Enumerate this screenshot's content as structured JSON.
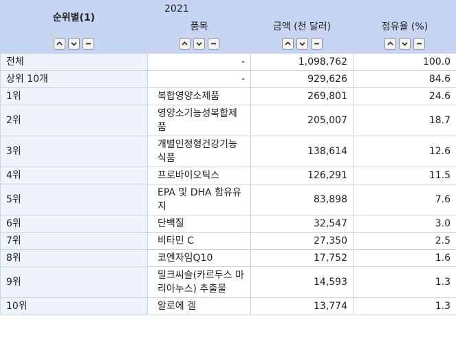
{
  "table": {
    "corner_label": "순위별(1)",
    "year": "2021",
    "columns": [
      "품목",
      "금액 (천 달러)",
      "점유율 (%)"
    ],
    "controls": {
      "up_icon": "chevron-up-icon",
      "down_icon": "chevron-down-icon",
      "minus_icon": "minus-icon"
    },
    "rows": [
      {
        "rank": "전체",
        "item": "-",
        "amount": "1,098,762",
        "share": "100.0"
      },
      {
        "rank": "상위 10개",
        "item": "-",
        "amount": "929,626",
        "share": "84.6"
      },
      {
        "rank": "1위",
        "item": "복합영양소제품",
        "amount": "269,801",
        "share": "24.6"
      },
      {
        "rank": "2위",
        "item": "영양소기능성복합제품",
        "amount": "205,007",
        "share": "18.7"
      },
      {
        "rank": "3위",
        "item": "개별인정형건강기능식품",
        "amount": "138,614",
        "share": "12.6"
      },
      {
        "rank": "4위",
        "item": "프로바이오틱스",
        "amount": "126,291",
        "share": "11.5"
      },
      {
        "rank": "5위",
        "item": "EPA 및 DHA 함유유지",
        "amount": "83,898",
        "share": "7.6"
      },
      {
        "rank": "6위",
        "item": "단백질",
        "amount": "32,547",
        "share": "3.0"
      },
      {
        "rank": "7위",
        "item": "비타민 C",
        "amount": "27,350",
        "share": "2.5"
      },
      {
        "rank": "8위",
        "item": "코엔자임Q10",
        "amount": "17,752",
        "share": "1.6"
      },
      {
        "rank": "9위",
        "item": "밀크씨슬(카르두스 마리아누스) 추출물",
        "amount": "14,593",
        "share": "1.3"
      },
      {
        "rank": "10위",
        "item": "알로에 겔",
        "amount": "13,774",
        "share": "1.3"
      }
    ]
  }
}
